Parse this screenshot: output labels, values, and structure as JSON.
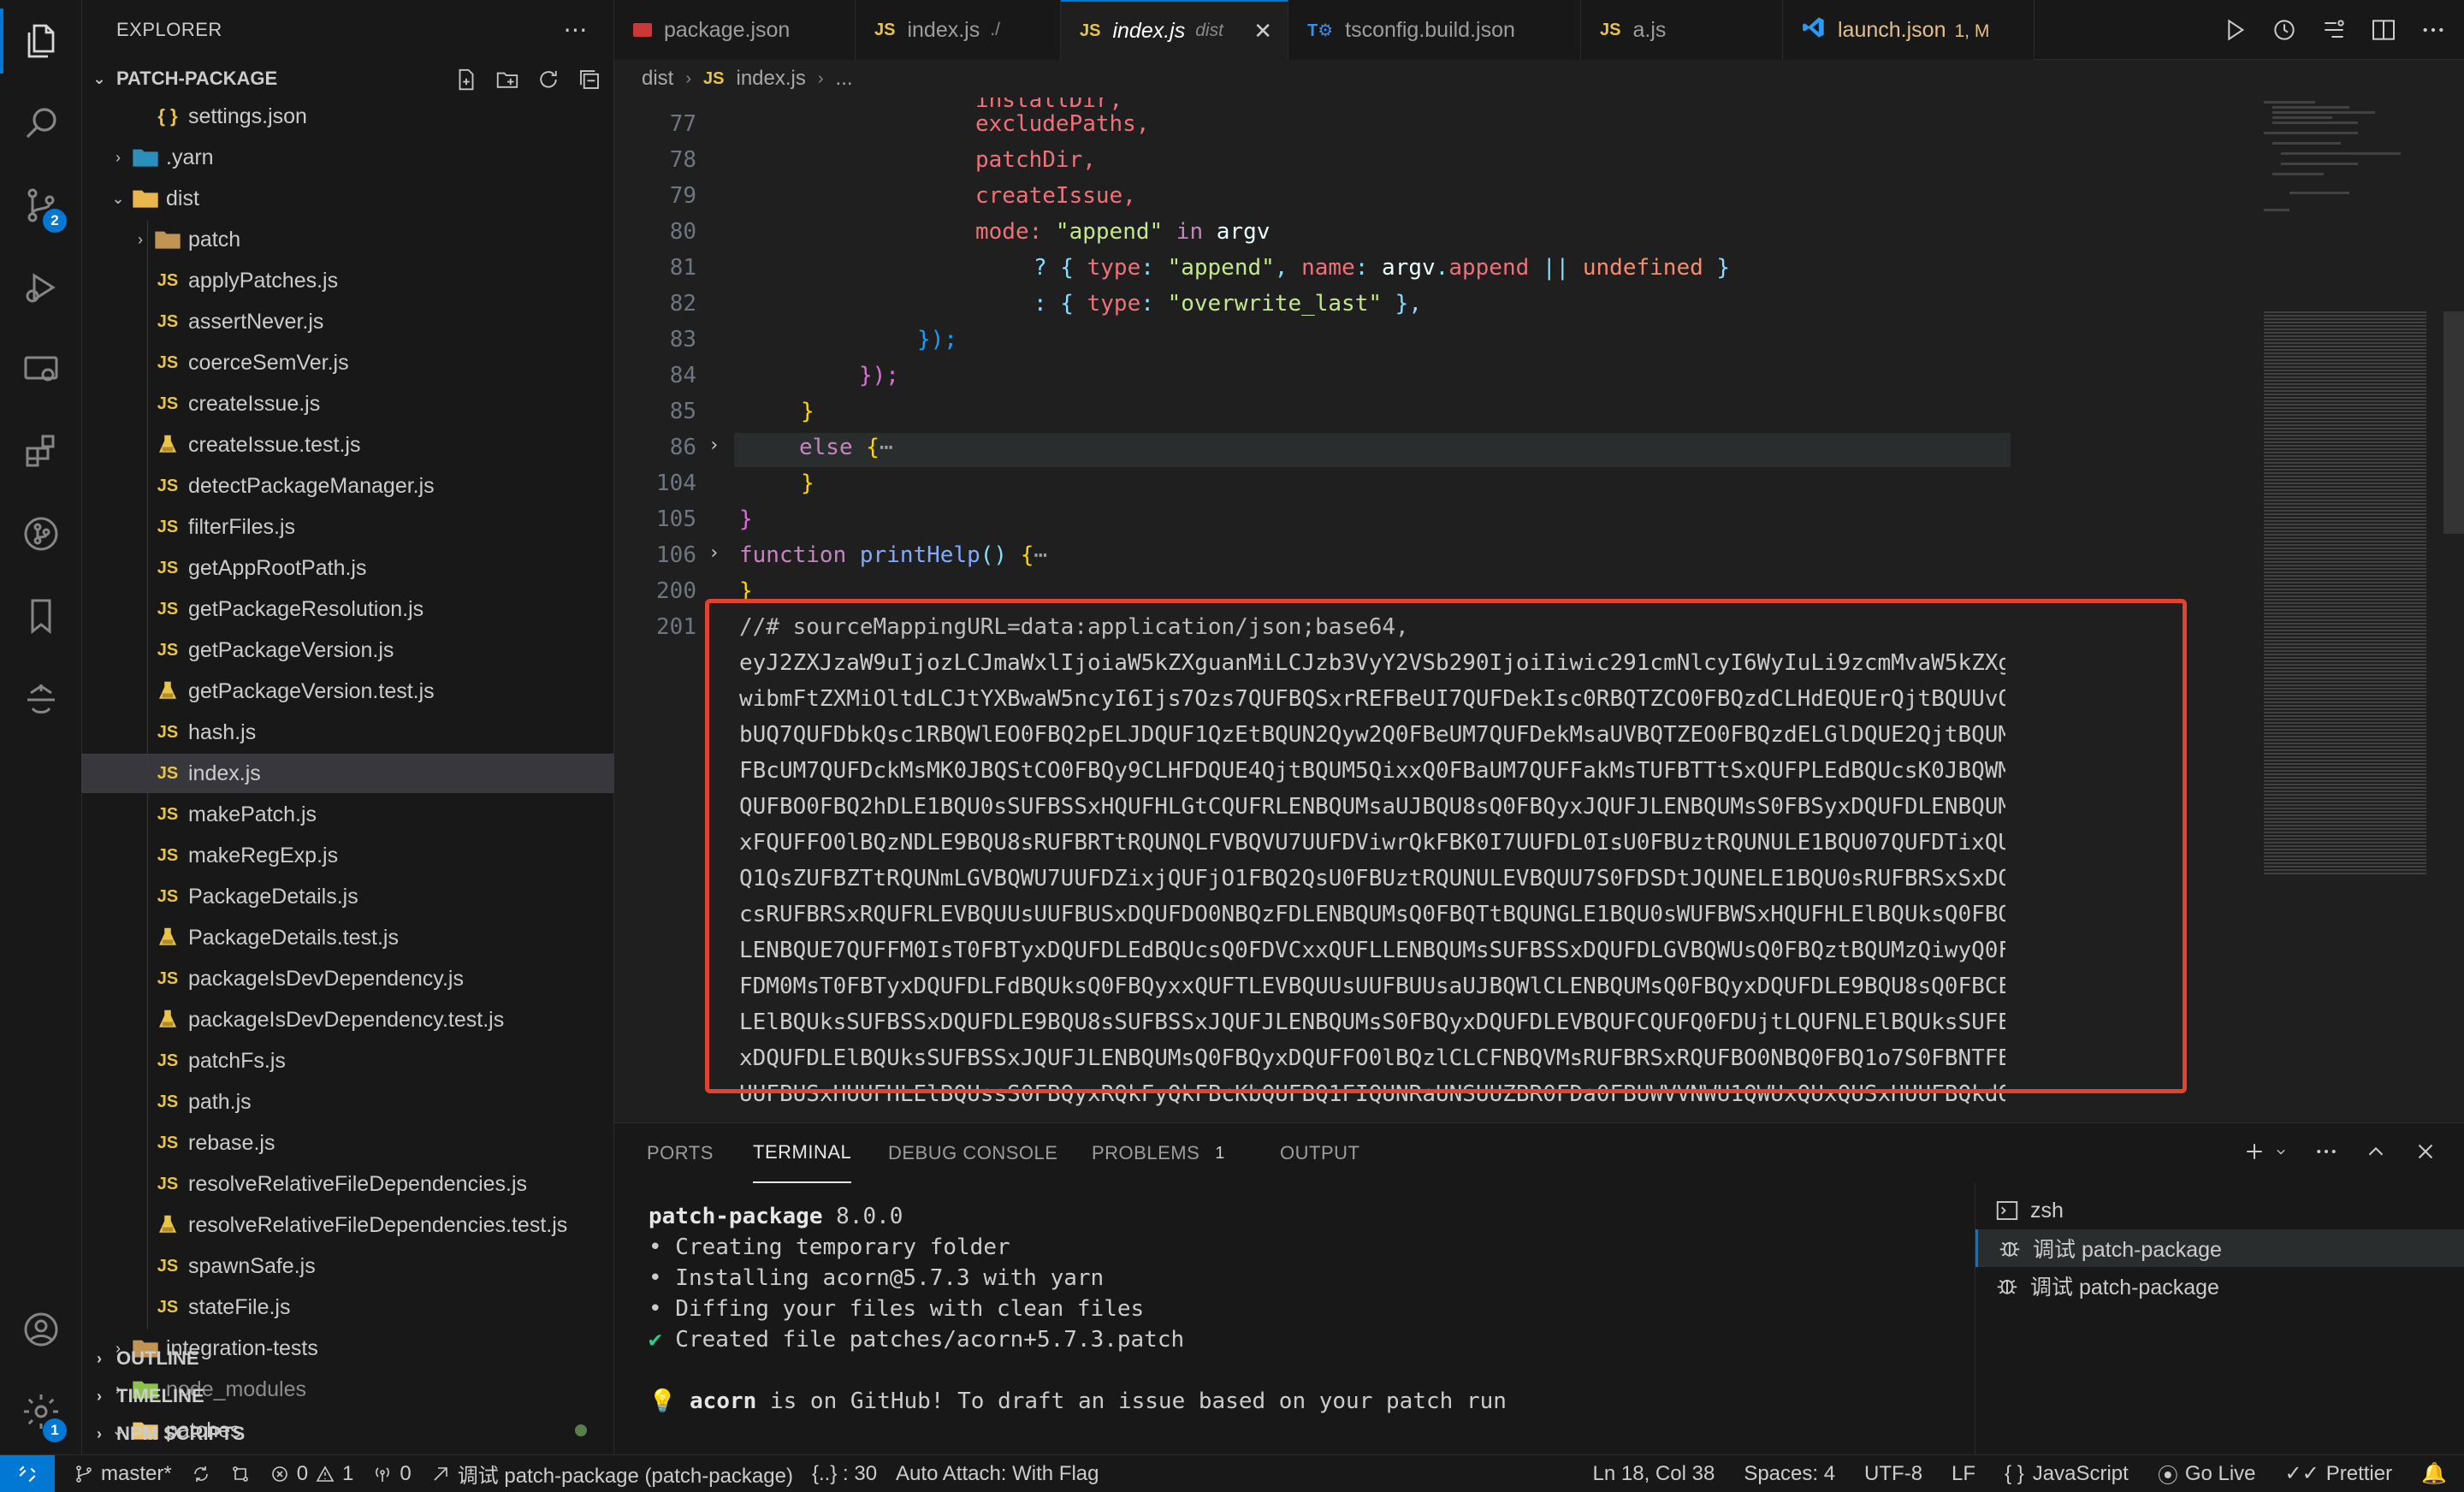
{
  "sidebar": {
    "title": "EXPLORER",
    "folder": "PATCH-PACKAGE",
    "tree": [
      {
        "label": "settings.json",
        "icon": "json",
        "depth": 2
      },
      {
        "label": ".yarn",
        "icon": "folder-yarn",
        "depth": 1,
        "collapsed": true
      },
      {
        "label": "dist",
        "icon": "folder-dist",
        "depth": 1,
        "expanded": true
      },
      {
        "label": "patch",
        "icon": "folder",
        "depth": 2,
        "collapsed": true
      },
      {
        "label": "applyPatches.js",
        "icon": "js",
        "depth": 2
      },
      {
        "label": "assertNever.js",
        "icon": "js",
        "depth": 2
      },
      {
        "label": "coerceSemVer.js",
        "icon": "js",
        "depth": 2
      },
      {
        "label": "createIssue.js",
        "icon": "js",
        "depth": 2
      },
      {
        "label": "createIssue.test.js",
        "icon": "test",
        "depth": 2
      },
      {
        "label": "detectPackageManager.js",
        "icon": "js",
        "depth": 2
      },
      {
        "label": "filterFiles.js",
        "icon": "js",
        "depth": 2
      },
      {
        "label": "getAppRootPath.js",
        "icon": "js",
        "depth": 2
      },
      {
        "label": "getPackageResolution.js",
        "icon": "js",
        "depth": 2
      },
      {
        "label": "getPackageVersion.js",
        "icon": "js",
        "depth": 2
      },
      {
        "label": "getPackageVersion.test.js",
        "icon": "test",
        "depth": 2
      },
      {
        "label": "hash.js",
        "icon": "js",
        "depth": 2
      },
      {
        "label": "index.js",
        "icon": "js",
        "depth": 2,
        "selected": true
      },
      {
        "label": "makePatch.js",
        "icon": "js",
        "depth": 2
      },
      {
        "label": "makeRegExp.js",
        "icon": "js",
        "depth": 2
      },
      {
        "label": "PackageDetails.js",
        "icon": "js",
        "depth": 2
      },
      {
        "label": "PackageDetails.test.js",
        "icon": "test",
        "depth": 2
      },
      {
        "label": "packageIsDevDependency.js",
        "icon": "js",
        "depth": 2
      },
      {
        "label": "packageIsDevDependency.test.js",
        "icon": "test",
        "depth": 2
      },
      {
        "label": "patchFs.js",
        "icon": "js",
        "depth": 2
      },
      {
        "label": "path.js",
        "icon": "js",
        "depth": 2
      },
      {
        "label": "rebase.js",
        "icon": "js",
        "depth": 2
      },
      {
        "label": "resolveRelativeFileDependencies.js",
        "icon": "js",
        "depth": 2
      },
      {
        "label": "resolveRelativeFileDependencies.test.js",
        "icon": "test",
        "depth": 2
      },
      {
        "label": "spawnSafe.js",
        "icon": "js",
        "depth": 2
      },
      {
        "label": "stateFile.js",
        "icon": "js",
        "depth": 2
      },
      {
        "label": "integration-tests",
        "icon": "folder",
        "depth": 1,
        "collapsed": true
      },
      {
        "label": "node_modules",
        "icon": "folder-node",
        "depth": 1,
        "collapsed": true,
        "dim": true
      },
      {
        "label": "patches",
        "icon": "folder-open",
        "depth": 1,
        "expanded": true,
        "modified": true
      }
    ],
    "sections": [
      "OUTLINE",
      "TIMELINE",
      "NPM SCRIPTS"
    ]
  },
  "activity_badges": {
    "scm": "2",
    "settings": "1"
  },
  "tabs": [
    {
      "label": "package.json",
      "icon": "npm"
    },
    {
      "label": "index.js",
      "desc": "./",
      "icon": "js"
    },
    {
      "label": "index.js",
      "desc": "dist",
      "icon": "js",
      "active": true
    },
    {
      "label": "tsconfig.build.json",
      "icon": "ts"
    },
    {
      "label": "a.js",
      "icon": "js"
    },
    {
      "label": "launch.json",
      "desc": "1, M",
      "icon": "vscode",
      "modified": true
    }
  ],
  "breadcrumb": {
    "folder": "dist",
    "file": "index.js",
    "more": "..."
  },
  "editor": {
    "line_numbers": [
      "77",
      "78",
      "79",
      "80",
      "81",
      "82",
      "83",
      "84",
      "85",
      "86",
      "104",
      "105",
      "106",
      "200",
      "201"
    ],
    "top_partial": "installDir,",
    "lines": {
      "l77": "excludePaths,",
      "l78": "patchDir,",
      "l79": "createIssue,",
      "l80_a": "mode: ",
      "l80_b": "\"append\"",
      "l80_c": " in ",
      "l80_d": "argv",
      "l81_a": "? { ",
      "l81_b": "type",
      "l81_c": ": ",
      "l81_d": "\"append\"",
      "l81_e": ", ",
      "l81_f": "name",
      "l81_g": ": ",
      "l81_h": "argv",
      "l81_i": ".",
      "l81_j": "append",
      "l81_k": " || ",
      "l81_l": "undefined",
      "l81_m": " }",
      "l82_a": ": { ",
      "l82_b": "type",
      "l82_c": ": ",
      "l82_d": "\"overwrite_last\"",
      "l82_e": " },",
      "l83": "});",
      "l84": "});",
      "l85": "}",
      "l86_a": "else ",
      "l86_b": "{",
      "l86_c": "⋯",
      "l104": "}",
      "l105": "}",
      "l106_a": "function ",
      "l106_b": "printHelp",
      "l106_c": "() ",
      "l106_d": "{",
      "l106_e": "⋯",
      "l200": "}",
      "l201": "//# sourceMappingURL=data:application/json;base64,"
    },
    "base64": [
      "eyJ2ZXJzaW9uIjozLCJmaWxlIjoiaW5kZXguanMiLCJzb3VyY2VSb290IjoiIiwic291cmNlcyI6WyIuLi9zcmMvaW5kZXgudHMiXS",
      "wibmFtZXMiOltdLCJtYXBwaW5ncyI6Ijs7Ozs7QUFBQSxrREFBeUI7QUFDekIsc0RBQTZCO0FBQzdCLHdEQUErQjtBQUUvQixpREFB",
      "bUQ7QUFDbkQsc1RBQWlEO0FBQ2pELJDQUF1QzEtBQUN2Qyw2Q0FBeUM7QUFDekMsaUVBQTZEO0FBQzdELGlDQUE2QjtBQUM3QiwrQk",
      "FBcUM7QUFDckMsMK0JBQStCO0FBQy9CLHFDQUE4QjtBQUM5QixxQ0FBaUM7QUFFakMsTUFBTTtSxQUFPLEdBQUcsK0JBQWMsRUFBRSxD",
      "QUFBO0FBQ2hDLE1BQU0sSUFBSSxHQUFHLGtCQUFRLENBQUMsaUJBQU8sQ0FBQyxJQUFJLENBQUMsS0FBSyxDQUFDLENBQUMsQ0FBQyxDQUFDLENBQUMsQ0FBQy0FBQy",
      "xFQUFFO0lBQzNDLE9BQU8sRUFBRTtRQUNQLFVBQVU7UUFDViwrQkFBK0I7UUFDL0IsU0FBUztRQUNULE1BQU07QUFDTixQUFFTD1FB",
      "Q1QsZUFBZTtRQUNmLGVBQWU7UUFDZixjQUFjO1FBQ2QsU0FBUztRQUNULEVBQUU7S0FDSDtJQUNELE1BQU0sRUFBRSxSxDQUFDLFdBQV",
      "csRUFBRSxRQUFRLEVBQUUsUUFBUSxDQUFDO0NBQzFDLENBQUMsQ0FBQTtBQUNGLE1BQU0sWUFBWSxHQUFHLElBQUksQ0FBQyxDQUFD",
      "LENBQUE7QUFFM0IsT0FBTyxDQUFDLEdBQUcsQ0FDVCxxQUFLLENBQUMsSUFBSSxDQUFDLGVBQWUsQ0FBQztBQUMzQiwyQ0FBQ0MuQkMxQ0FBQU",
      "FDM0MsT0FBTyxDQUFDLFdBQUksQ0FBQyxxQUFTLEVBQUUsUUFBUUsaUJBQWlCLENBQUMsQ0FBQyxDQUFDLE9BQU8sQ0FBCEQsQ0FBQ0QsQ0FBQVVE",
      "LElBQUksSUFBSSxDQUFDLE9BQU8sSUFBSSxJQUFJLENBQUMsS0FBQyxDQUFDLEVBQUFCQUFQ0FDUjtLQUFNLElBQUksSUFBSS",
      "xDQUFDLElBQUksSUFBSSxJQUFJLENBQUMsQ0FBQyxDQUFFO0lBQzlCLCFNBQVMsRUFBRSxRQUFBO0NBQ0FBQ1o7S0FBNTFBTtJQUNNLE1BQQ0s",
      "UUFBUSxHUUFHLElBQUssS0FBQyxRQkFyQkFBcKbQUFBQ1FIQUNRaUNSUUZBR0FDa0FBUWVVNWU1QWUxQUxQUSxHUUFBQkdQUFCQkZTUFBMBZS"
    ]
  },
  "panel": {
    "tabs": [
      {
        "label": "PORTS"
      },
      {
        "label": "TERMINAL",
        "active": true
      },
      {
        "label": "DEBUG CONSOLE"
      },
      {
        "label": "PROBLEMS",
        "badge": "1"
      },
      {
        "label": "OUTPUT"
      }
    ],
    "terminal": {
      "l1_name": "patch-package",
      "l1_ver": " 8.0.0",
      "l2": "• Creating temporary folder",
      "l3": "• Installing acorn@5.7.3 with yarn",
      "l4": "• Diffing your files with clean files",
      "l5_mark": "✔",
      "l5": " Created file patches/acorn+5.7.3.patch",
      "l6_bulb": "💡",
      "l6_bold": "acorn",
      "l6": " is on GitHub! To draft an issue based on your patch run"
    },
    "terminals": [
      {
        "label": "zsh",
        "icon": "terminal-icon"
      },
      {
        "label": "调试 patch-package",
        "icon": "debug-icon",
        "selected": true
      },
      {
        "label": "调试 patch-package",
        "icon": "debug-icon"
      }
    ]
  },
  "status": {
    "branch": "master*",
    "errors": "0",
    "warnings": "1",
    "ports": "0",
    "debug": "调试 patch-package (patch-package)",
    "braces": "{..} : 30",
    "auto_attach": "Auto Attach: With Flag",
    "position": "Ln 18, Col 38",
    "spaces": "Spaces: 4",
    "encoding": "UTF-8",
    "eol": "LF",
    "language": "JavaScript",
    "go_live": "Go Live",
    "prettier": "Prettier"
  },
  "colors": {
    "accent": "#0078d4",
    "highlight_box": "#e0432f",
    "js_icon": "#e8c54a"
  }
}
